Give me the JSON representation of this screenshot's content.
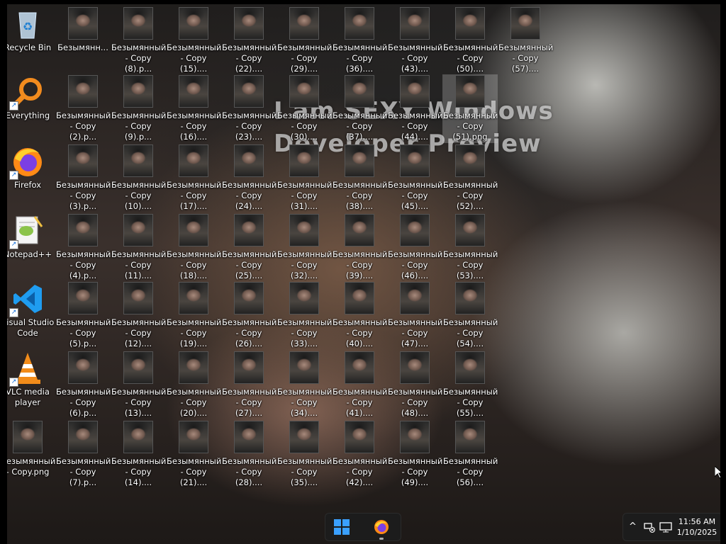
{
  "wallpaper": {
    "watermark_line1": "I am SEXY Windows",
    "watermark_line2": "Developer Preview"
  },
  "system_icons": [
    {
      "name": "recycle-bin",
      "label": "Recycle Bin",
      "icon": "recycle-bin-icon"
    },
    {
      "name": "everything",
      "label": "Everything",
      "icon": "everything-search-icon"
    },
    {
      "name": "firefox",
      "label": "Firefox",
      "icon": "firefox-icon"
    },
    {
      "name": "notepad-plus-plus",
      "label": "Notepad++",
      "icon": "notepad-plus-plus-icon"
    },
    {
      "name": "visual-studio-code",
      "label": "Visual Studio Code",
      "icon": "vscode-icon"
    },
    {
      "name": "vlc-media-player",
      "label": "VLC media player",
      "icon": "vlc-icon"
    },
    {
      "name": "copy-png",
      "label": "Безымянный - Copy.png",
      "icon": "image-thumbnail-icon"
    }
  ],
  "file_icon_text": {
    "first": "Безымянн...",
    "prefix": "Безымянный",
    "copy_prefix": "- Copy (",
    "suffix_short": ").p...",
    "suffix_long": ")....",
    "copy_word": "- Copy",
    "selected_ext": ".png"
  },
  "taskbar": {
    "start_icon": "windows-start-icon",
    "firefox_icon": "firefox-icon",
    "tray_chevron_icon": "chevron-up-icon",
    "network_icon": "network-disconnected-icon",
    "monitor_icon": "display-icon",
    "time": "11:56 AM",
    "date": "1/10/2025"
  }
}
